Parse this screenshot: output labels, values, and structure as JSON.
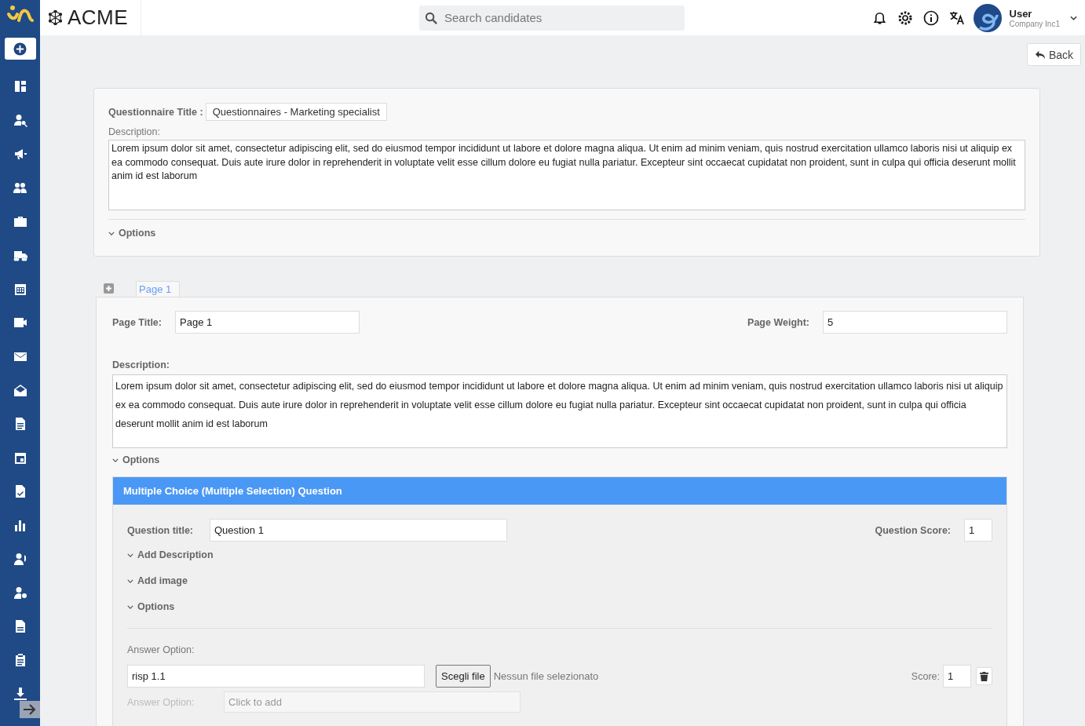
{
  "header": {
    "brand": "ACME",
    "search": {
      "placeholder": "Search candidates"
    },
    "user": {
      "name": "User",
      "company": "Company Inc1"
    }
  },
  "back_button": "Back",
  "questionnaire": {
    "title_label": "Questionnaire Title :",
    "title_value": "Questionnaires - Marketing specialist",
    "description_label": "Description:",
    "description": "Lorem ipsum dolor sit amet, consectetur adipiscing elit, sed do eiusmod tempor incididunt ut labore et dolore magna aliqua. Ut enim ad minim veniam, quis nostrud exercitation ullamco laboris nisi ut aliquip ex ea commodo consequat. Duis aute irure dolor in reprehenderit in voluptate velit esse cillum dolore eu fugiat nulla pariatur. Excepteur sint occaecat cupidatat non proident, sunt in culpa qui officia deserunt mollit anim id est laborum",
    "options_label": "Options"
  },
  "page_tabs": [
    {
      "label": "Page 1",
      "selected": true
    }
  ],
  "page": {
    "title_label": "Page Title:",
    "title_value": "Page 1",
    "weight_label": "Page Weight:",
    "weight_value": "5",
    "description_label": "Description:",
    "description": "Lorem ipsum dolor sit amet, consectetur adipiscing elit, sed do eiusmod tempor incididunt ut labore et dolore magna aliqua. Ut enim ad minim veniam, quis nostrud exercitation ullamco laboris nisi ut aliquip ex ea commodo consequat. Duis aute irure dolor in reprehenderit in voluptate velit esse cillum dolore eu fugiat nulla pariatur. Excepteur sint occaecat cupidatat non proident, sunt in culpa qui officia deserunt mollit anim id est laborum",
    "options_label": "Options"
  },
  "question": {
    "header": "Multiple Choice (Multiple Selection) Question",
    "title_label": "Question title:",
    "title_value": "Question 1",
    "score_label": "Question Score:",
    "score_value": "1",
    "sections": [
      "Add Description",
      "Add image",
      "Options"
    ],
    "answers": [
      {
        "label": "Answer Option:",
        "value": "risp 1.1",
        "file_button": "Scegli file",
        "file_status": "Nessun file selezionato",
        "score_label": "Score:",
        "score_value": "1"
      }
    ],
    "new_answer": {
      "label": "Answer Option:",
      "placeholder": "Click to add"
    }
  }
}
